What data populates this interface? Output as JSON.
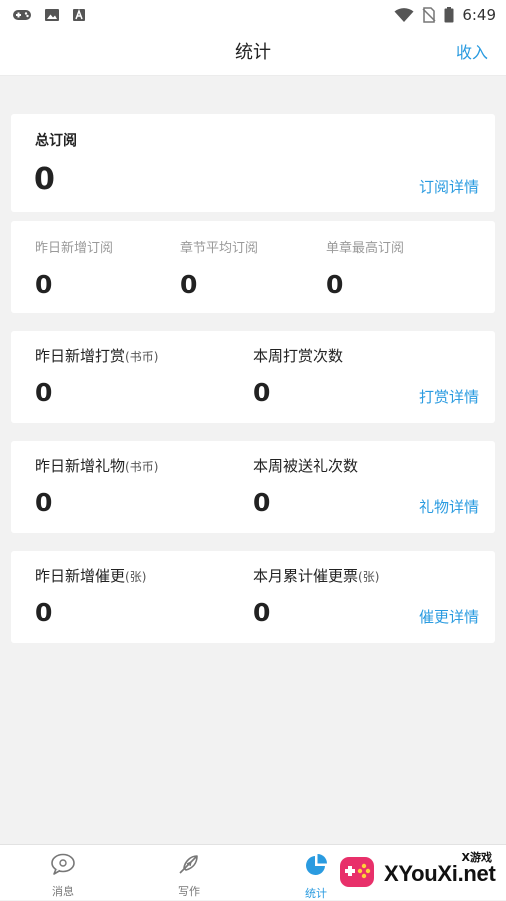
{
  "status_bar": {
    "time": "6:49",
    "left_icons": [
      "gamepad-icon",
      "image-icon",
      "text-a-icon"
    ],
    "right_icons": [
      "wifi-icon",
      "no-sim-icon",
      "battery-icon"
    ]
  },
  "header": {
    "title": "统计",
    "action": "收入"
  },
  "total": {
    "label": "总订阅",
    "value": "0",
    "link": "订阅详情"
  },
  "sub_stats": [
    {
      "label": "昨日新增订阅",
      "value": "0"
    },
    {
      "label": "章节平均订阅",
      "value": "0"
    },
    {
      "label": "单章最高订阅",
      "value": "0"
    }
  ],
  "reward": {
    "left_label": "昨日新增打赏",
    "left_unit": "(书币)",
    "left_value": "0",
    "right_label": "本周打赏次数",
    "right_unit": "",
    "right_value": "0",
    "link": "打赏详情"
  },
  "gift": {
    "left_label": "昨日新增礼物",
    "left_unit": "(书币)",
    "left_value": "0",
    "right_label": "本周被送礼次数",
    "right_unit": "",
    "right_value": "0",
    "link": "礼物详情"
  },
  "urge": {
    "left_label": "昨日新增催更",
    "left_unit": "(张)",
    "left_value": "0",
    "right_label": "本月累计催更票",
    "right_unit": "(张)",
    "right_value": "0",
    "link": "催更详情"
  },
  "tabbar": {
    "tabs": [
      {
        "label": "消息",
        "icon": "chat-bubble-icon"
      },
      {
        "label": "写作",
        "icon": "quill-icon"
      },
      {
        "label": "统计",
        "icon": "pie-chart-icon"
      }
    ],
    "active_index": 2
  },
  "watermark": {
    "text": "XYouXi.net",
    "small": "X游戏"
  },
  "colors": {
    "accent": "#2a9be0",
    "background": "#f2f2f2"
  }
}
